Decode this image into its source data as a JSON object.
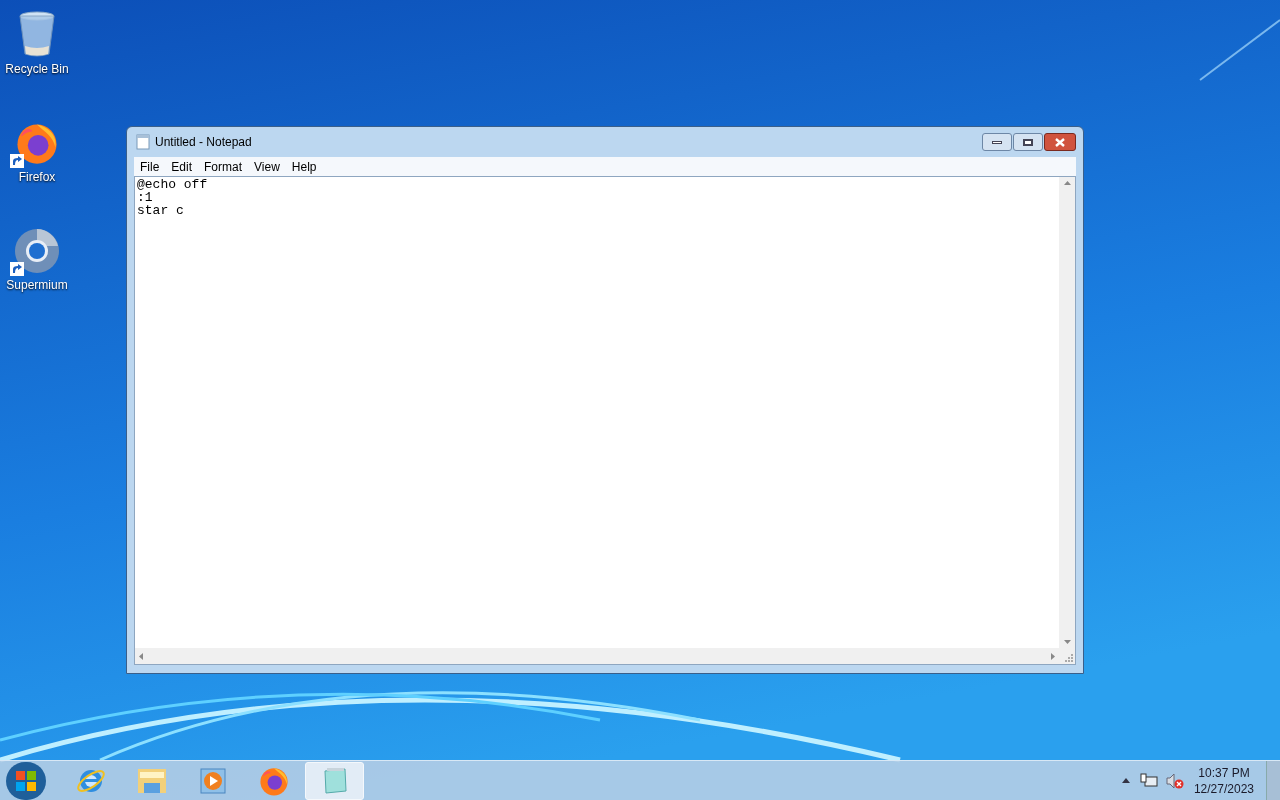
{
  "desktop_icons": [
    {
      "label": "Recycle Bin",
      "kind": "recycle"
    },
    {
      "label": "Firefox",
      "kind": "firefox"
    },
    {
      "label": "Supermium",
      "kind": "chromium"
    }
  ],
  "window": {
    "title": "Untitled - Notepad",
    "menu": [
      "File",
      "Edit",
      "Format",
      "View",
      "Help"
    ],
    "lines": [
      "@echo off",
      ":1",
      "star c"
    ]
  },
  "taskbar": {
    "apps": [
      {
        "kind": "ie",
        "selected": false
      },
      {
        "kind": "explorer",
        "selected": false
      },
      {
        "kind": "media",
        "selected": false
      },
      {
        "kind": "firefox",
        "selected": false
      },
      {
        "kind": "notepad",
        "selected": true
      }
    ],
    "clock": {
      "time": "10:37 PM",
      "date": "12/27/2023"
    }
  }
}
